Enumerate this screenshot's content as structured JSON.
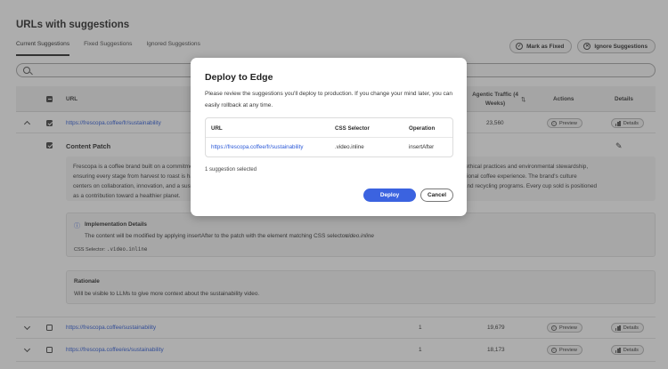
{
  "page": {
    "title": "URLs with suggestions"
  },
  "tabs": [
    {
      "label": "Current Suggestions",
      "active": true
    },
    {
      "label": "Fixed Suggestions",
      "active": false
    },
    {
      "label": "Ignored Suggestions",
      "active": false
    }
  ],
  "top_actions": {
    "mark_fixed": "Mark as Fixed",
    "ignore": "Ignore Suggestions"
  },
  "search": {
    "placeholder": ""
  },
  "table": {
    "columns": {
      "url": "URL",
      "agentic": "Agentic Traffic (4 Weeks)",
      "actions": "Actions",
      "details": "Details"
    },
    "rows": [
      {
        "url": "https://frescopa.coffee/fr/sustainability",
        "count": "",
        "traffic": "23,560",
        "expanded": true,
        "checked": true
      },
      {
        "url": "https://frescopa.coffee/sustainability",
        "count": "1",
        "traffic": "19,679",
        "expanded": false,
        "checked": false
      },
      {
        "url": "https://frescopa.coffee/es/sustainability",
        "count": "1",
        "traffic": "18,173",
        "expanded": false,
        "checked": false
      }
    ],
    "preview_label": "Preview",
    "details_label": "Details"
  },
  "content_patch": {
    "title": "Content Patch",
    "text_lines": [
      "Frescopa is a coffee brand built on a commitment",
      "ensuring every stage from harvest to roast is har",
      "centers on collaboration, innovation, and a sustai",
      "as a contribution toward a healthier planet."
    ],
    "text_lines_right": [
      "old ethical practices and environmental stewardship,",
      "ceptional coffee experience. The brand's culture",
      "ng and recycling programs. Every cup sold is positioned"
    ],
    "impl_title": "Implementation Details",
    "impl_text": "The content will be modified by applying insertAfter to the patch with the element matching CSS selector:",
    "impl_selector": "video.inline",
    "css_selector_label": "CSS Selector:",
    "css_selector_value": ".video.inline",
    "rationale_title": "Rationale",
    "rationale_text": "Will be visible to LLMs to give more context about the sustainability video."
  },
  "modal": {
    "title": "Deploy to Edge",
    "description": "Please review the suggestions you'll deploy to production. If you change your mind later, you can easily rollback at any time.",
    "columns": {
      "url": "URL",
      "selector": "CSS Selector",
      "operation": "Operation"
    },
    "row": {
      "url": "https://frescopa.coffee/fr/sustainability",
      "selector": ".video.inline",
      "operation": "insertAfter"
    },
    "selected": "1 suggestion selected",
    "deploy": "Deploy",
    "cancel": "Cancel"
  },
  "colors": {
    "accent": "#3b63e0",
    "link": "#2c5ad8",
    "overlay": "rgba(60,60,60,0.42)"
  }
}
